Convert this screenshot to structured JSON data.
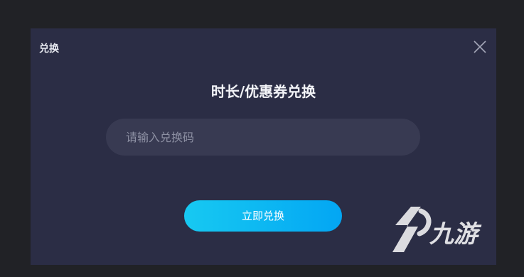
{
  "dialog": {
    "title": "兑换",
    "heading": "时长/优惠券兑换",
    "input": {
      "placeholder": "请输入兑换码",
      "value": ""
    },
    "submit_label": "立即兑换",
    "close_icon": "close-icon"
  },
  "watermark": {
    "text": "九游",
    "logo_icon": "jiuyou-logo-icon"
  },
  "colors": {
    "page_background": "#212226",
    "dialog_background": "#2b2d45",
    "input_background": "#383a52",
    "accent_start": "#17c9f2",
    "accent_end": "#03a6f3"
  }
}
